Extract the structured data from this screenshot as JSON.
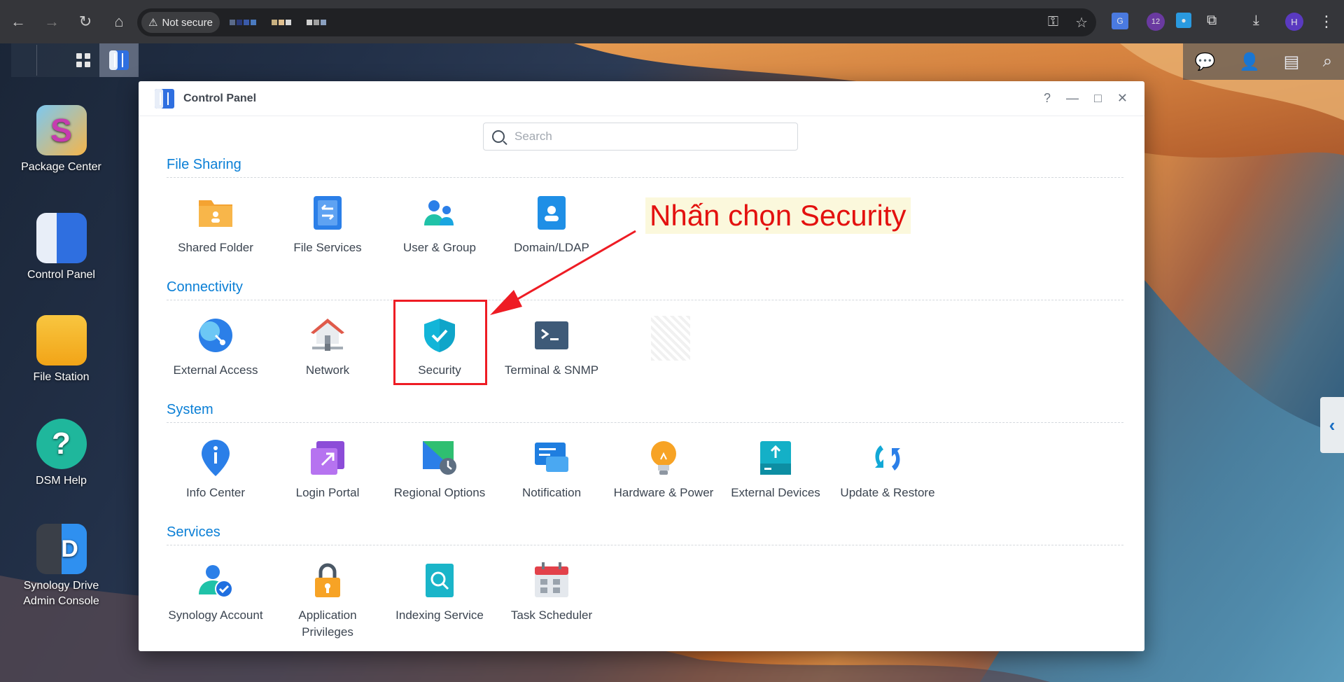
{
  "browser": {
    "back": "←",
    "forward": "→",
    "reload": "↻",
    "home": "⌂",
    "security_label": "Not secure",
    "ext_badge": "12",
    "profile_initial": "H",
    "menu": "⋮"
  },
  "window": {
    "title": "Control Panel",
    "help": "?",
    "minimize": "—",
    "maximize": "□",
    "close": "✕"
  },
  "search": {
    "placeholder": "Search"
  },
  "sections": [
    {
      "title": "File Sharing",
      "items": [
        "Shared Folder",
        "File Services",
        "User & Group",
        "Domain/LDAP"
      ]
    },
    {
      "title": "Connectivity",
      "items": [
        "External Access",
        "Network",
        "Security",
        "Terminal & SNMP"
      ]
    },
    {
      "title": "System",
      "items": [
        "Info Center",
        "Login Portal",
        "Regional Options",
        "Notification",
        "Hardware & Power",
        "External Devices",
        "Update & Restore"
      ]
    },
    {
      "title": "Services",
      "items": [
        "Synology Account",
        "Application Privileges",
        "Indexing Service",
        "Task Scheduler"
      ]
    }
  ],
  "desktop": [
    "Package Center",
    "Control Panel",
    "File Station",
    "DSM Help",
    "Synology Drive Admin Console"
  ],
  "annotation": {
    "text": "Nhấn chọn Security",
    "color": "#e3110f"
  },
  "accent": "#0a7fd6",
  "sidebar_toggle": "‹"
}
